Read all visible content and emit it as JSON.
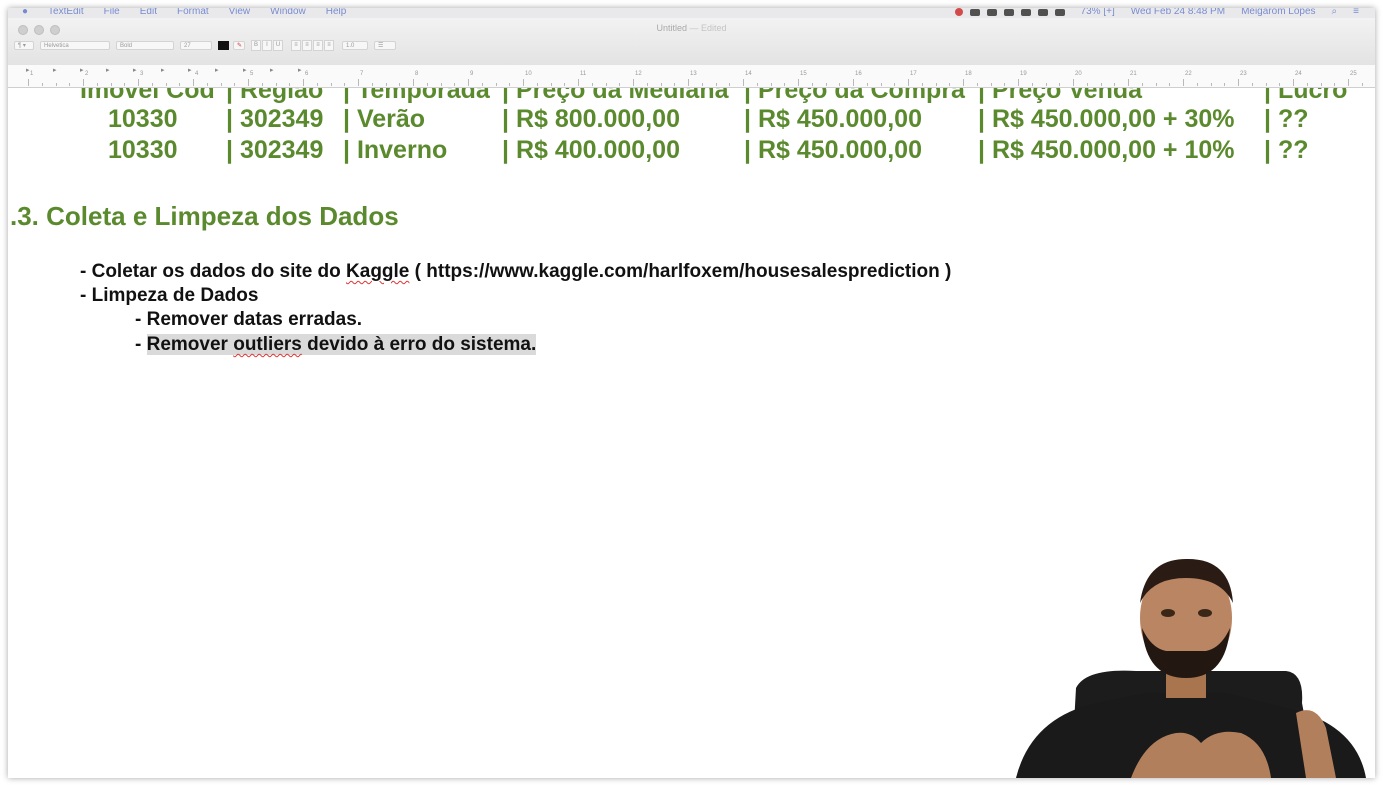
{
  "menubar": {
    "app": "TextEdit",
    "menus": [
      "File",
      "Edit",
      "Format",
      "View",
      "Window",
      "Help"
    ],
    "battery": "73% [+]",
    "clock": "Wed Feb 24  8:48 PM",
    "user": "Meigarom Lopes"
  },
  "window": {
    "title": "Untitled",
    "status": "— Edited"
  },
  "toolbar": {
    "paragraph_style": "¶ ▾",
    "font_family": "Helvetica",
    "font_style": "Bold",
    "font_size": "27",
    "bold": "B",
    "italic": "I",
    "underline": "U",
    "line_spacing": "1.0",
    "text_color": "#000000"
  },
  "ruler": {
    "numbers": [
      "1",
      "2",
      "3",
      "4",
      "5",
      "6",
      "7",
      "8",
      "9",
      "10",
      "11",
      "12",
      "13",
      "14",
      "15",
      "16",
      "17",
      "18",
      "19",
      "20",
      "21",
      "22",
      "23",
      "24",
      "25"
    ]
  },
  "table": {
    "header": [
      "Imóvel Cod",
      "| Região",
      "| Temporada",
      "| Preço da Mediana",
      "| Preço da Compra",
      "| Preço Venda",
      "| Lucro"
    ],
    "rows": [
      [
        "10330",
        "| 302349",
        "| Verão",
        "| R$ 800.000,00",
        "| R$ 450.000,00",
        "| R$ 450.000,00 + 30%",
        "| ??"
      ],
      [
        "10330",
        "| 302349",
        "| Inverno",
        "| R$ 400.000,00",
        "| R$ 450.000,00",
        "| R$ 450.000,00 + 10%",
        "| ??"
      ]
    ]
  },
  "section": {
    "heading": ".3. Coleta e Limpeza dos Dados",
    "b1_pre": "- Coletar os dados do site do ",
    "b1_kaggle": "Kaggle",
    "b1_post": " ( https://www.kaggle.com/harlfoxem/housesalesprediction )",
    "b2": "- Limpeza de Dados",
    "b2a": "- Remover datas erradas.",
    "b2b_pre": "Remover ",
    "b2b_outliers": "outliers",
    "b2b_post": " devido à erro do sistema.",
    "b2b_dash": "- "
  },
  "colors": {
    "heading_green": "#5b8a2e",
    "body_text": "#111111",
    "selection": "#dadada"
  }
}
